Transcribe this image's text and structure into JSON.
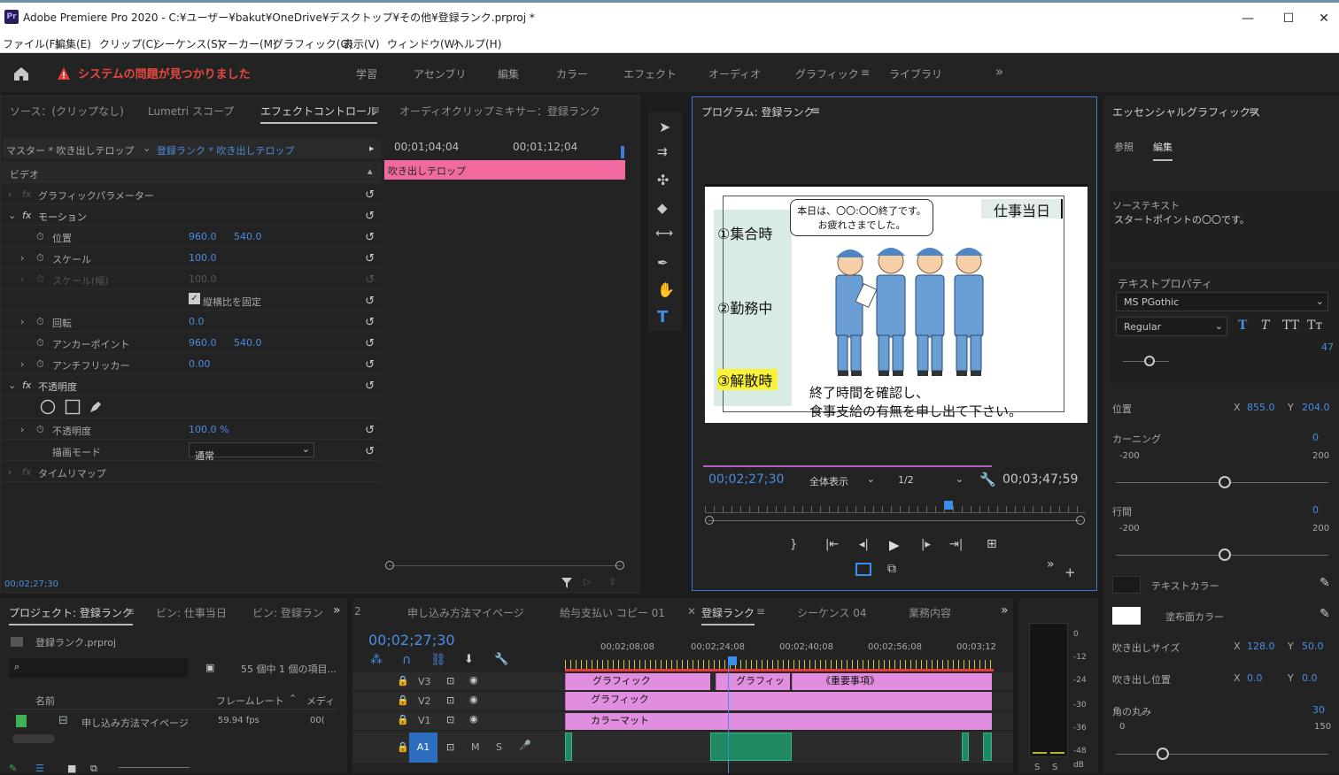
{
  "window": {
    "title": "Adobe Premiere Pro 2020 - C:¥ユーザー¥bakut¥OneDrive¥デスクトップ¥その他¥登録ランク.prproj *",
    "logo": "Pr",
    "min": "—",
    "max": "☐",
    "close": "✕"
  },
  "menu": [
    "ファイル(F)",
    "編集(E)",
    "クリップ(C)",
    "シーケンス(S)",
    "マーカー(M)",
    "グラフィック(G)",
    "表示(V)",
    "ウィンドウ(W)",
    "ヘルプ(H)"
  ],
  "workspace": {
    "alert": "システムの問題が見つかりました",
    "tabs": [
      "学習",
      "アセンブリ",
      "編集",
      "カラー",
      "エフェクト",
      "オーディオ",
      "グラフィック",
      "ライブラリ"
    ],
    "active": "グラフィック",
    "more": "»"
  },
  "effects": {
    "tabs": [
      "ソース：(クリップなし)",
      "Lumetri スコープ",
      "エフェクトコントロール",
      "オーディオクリップミキサー：登録ランク"
    ],
    "master": "マスター * 吹き出しテロップ",
    "seq": "登録ランク * 吹き出しテロップ",
    "tc1": "00;01;04;04",
    "tc2": "00;01;12;04",
    "clip": "吹き出しテロップ",
    "section": "ビデオ",
    "rows": {
      "graphic_params": "グラフィックパラメーター",
      "motion": "モーション",
      "position": "位置",
      "pos_x": "960.0",
      "pos_y": "540.0",
      "scale": "スケール",
      "scale_v": "100.0",
      "scale_w": "スケール(幅)",
      "scale_w_v": "100.0",
      "uniform": "縦横比を固定",
      "rotation": "回転",
      "rot_v": "0.0",
      "anchor": "アンカーポイント",
      "anc_x": "960.0",
      "anc_y": "540.0",
      "flicker": "アンチフリッカー",
      "flicker_v": "0.00",
      "opacity": "不透明度",
      "opacity_row": "不透明度",
      "opacity_v": "100.0 %",
      "blend": "描画モード",
      "blend_v": "通常",
      "timeremap": "タイムリマップ"
    },
    "status_tc": "00;02;27;30"
  },
  "program": {
    "title": "プログラム: 登録ランク",
    "tc": "00;02;27;30",
    "fit": "全体表示",
    "res": "1/2",
    "dur": "00;03;47;59",
    "frame": {
      "top_bubble_1": "本日は、〇〇:〇〇終了です。",
      "top_bubble_2": "お疲れさまでした。",
      "right_title": "仕事当日",
      "i1": "①集合時",
      "i2": "②勤務中",
      "i3": "③解散時",
      "bottom_1": "終了時間を確認し、",
      "bottom_2": "食事支給の有無を申し出て下さい。"
    }
  },
  "essential": {
    "title": "エッセンシャルグラフィックス",
    "tabs": [
      "参照",
      "編集"
    ],
    "src_label": "ソーステキスト",
    "src_text": "スタートポイントの〇〇です。",
    "text_props": "テキストプロパティ",
    "font": "MS PGothic",
    "style": "Regular",
    "size": "47",
    "position": "位置",
    "pos_x": "855.0",
    "pos_y": "204.0",
    "kerning": "カーニング",
    "kern_v": "0",
    "kern_min": "-200",
    "kern_max": "200",
    "leading": "行間",
    "lead_v": "0",
    "lead_min": "-200",
    "lead_max": "200",
    "text_color": "テキストカラー",
    "bg_color": "塗布面カラー",
    "bubble_size": "吹き出しサイズ",
    "bs_x": "128.0",
    "bs_y": "50.0",
    "bubble_pos": "吹き出し位置",
    "bp_x": "0.0",
    "bp_y": "0.0",
    "radius": "角の丸み",
    "rad_v": "30",
    "rad_min": "0",
    "rad_max": "150",
    "xl": "X",
    "yl": "Y"
  },
  "project": {
    "tabs": [
      "プロジェクト: 登録ランク",
      "ビン: 仕事当日",
      "ビン: 登録ラン"
    ],
    "file": "登録ランク.prproj",
    "count": "55 個中 1 個の項目...",
    "cols": [
      "名前",
      "フレームレート",
      "メディ"
    ],
    "item": "申し込み方法マイページ",
    "fps": "59.94 fps",
    "media": "00("
  },
  "timeline": {
    "tabs": [
      "申し込み方法マイページ",
      "給与支払い コピー 01",
      "登録ランク",
      "シーケンス 04",
      "業務内容"
    ],
    "tc": "00;02;27;30",
    "ruler": [
      "00;02;08;08",
      "00;02;24;08",
      "00;02;40;08",
      "00;02;56;08",
      "00;03;12"
    ],
    "tracks": [
      "V3",
      "V2",
      "V1",
      "A1"
    ],
    "clips": {
      "g1": "グラフィック",
      "g2": "グラフィッ",
      "g3": "《重要事項》",
      "g4": "グラフィック",
      "cm": "カラーマット"
    }
  },
  "meter": {
    "labels": [
      "0",
      "-12",
      "-24",
      "-30",
      "-36",
      "-48",
      "dB"
    ],
    "s": "S"
  }
}
